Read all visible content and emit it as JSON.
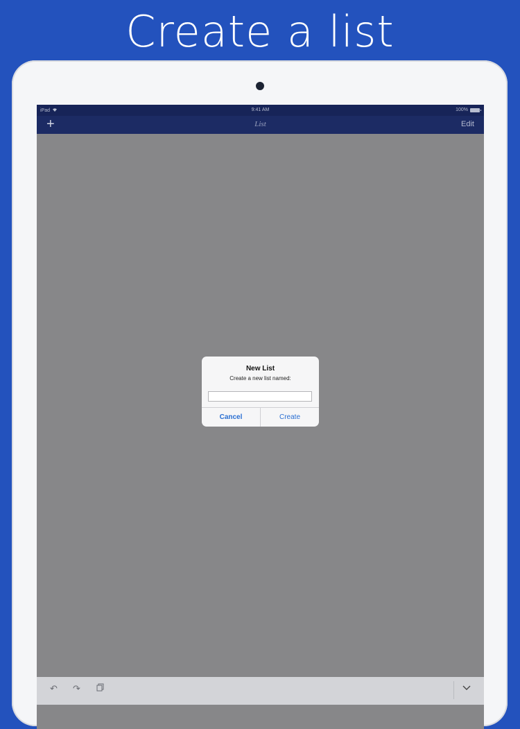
{
  "headline": "Create a list",
  "status_bar": {
    "carrier": "iPad",
    "wifi_icon": "wifi-icon",
    "time": "9:41 AM",
    "battery": "100%"
  },
  "nav": {
    "add_icon": "plus-icon",
    "title": "List",
    "edit_label": "Edit"
  },
  "dialog": {
    "title": "New List",
    "message": "Create a new list named:",
    "input_value": "",
    "cancel_label": "Cancel",
    "create_label": "Create"
  },
  "keyboard_toolbar": {
    "icons": [
      "undo-icon",
      "redo-icon",
      "paste-icon",
      "keyboard-dismiss-icon"
    ]
  },
  "colors": {
    "background": "#2352bd",
    "navbar": "#1c2b64",
    "accent": "#2a6fd2",
    "dim_overlay": "#878789"
  }
}
